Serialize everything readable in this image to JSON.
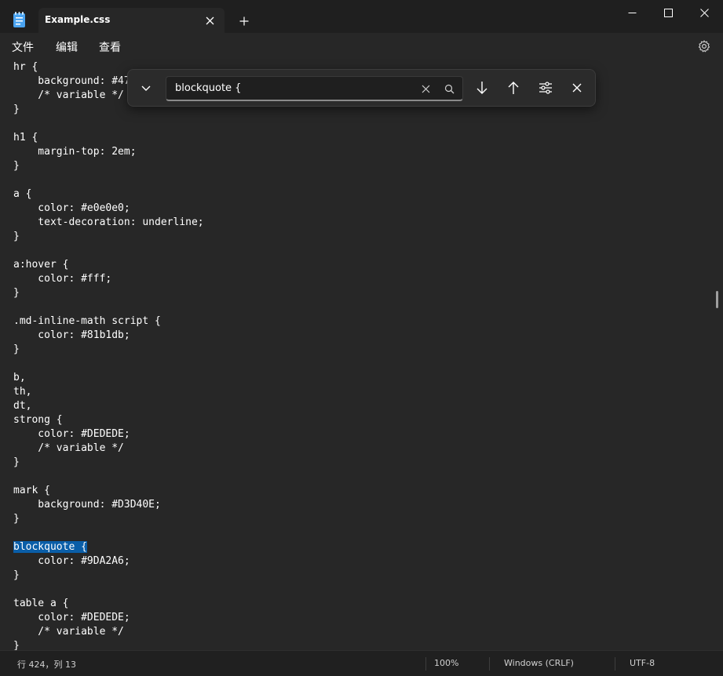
{
  "titlebar": {
    "icon": "notepad-icon",
    "tab_title": "Example.css",
    "tab_close_icon": "close-icon",
    "new_tab_icon": "plus-icon",
    "window_buttons": [
      "minimize-icon",
      "maximize-icon",
      "close-icon"
    ]
  },
  "menu": {
    "file": "文件",
    "edit": "编辑",
    "view": "查看",
    "settings_icon": "gear-icon"
  },
  "find": {
    "query": "blockquote {",
    "buttons": [
      "chevron-down-icon",
      "clear-icon",
      "search-icon",
      "arrow-down-icon",
      "arrow-up-icon",
      "options-icon",
      "close-icon"
    ]
  },
  "editor": {
    "lines": [
      "hr {",
      "    background: #47",
      "    /* variable */",
      "}",
      "",
      "h1 {",
      "    margin-top: 2em;",
      "}",
      "",
      "a {",
      "    color: #e0e0e0;",
      "    text-decoration: underline;",
      "}",
      "",
      "a:hover {",
      "    color: #fff;",
      "}",
      "",
      ".md-inline-math script {",
      "    color: #81b1db;",
      "}",
      "",
      "b,",
      "th,",
      "dt,",
      "strong {",
      "    color: #DEDEDE;",
      "    /* variable */",
      "}",
      "",
      "mark {",
      "    background: #D3D40E;",
      "}",
      "",
      "blockquote {",
      "    color: #9DA2A6;",
      "}",
      "",
      "table a {",
      "    color: #DEDEDE;",
      "    /* variable */",
      "}"
    ],
    "highlighted_line": 34
  },
  "status": {
    "position": "行 424，列 13",
    "zoom": "100%",
    "line_ending": "Windows (CRLF)",
    "encoding": "UTF-8"
  },
  "colors": {
    "selection": "#0a5ea8",
    "background": "#272727",
    "titlebar": "#1f1f1f"
  }
}
